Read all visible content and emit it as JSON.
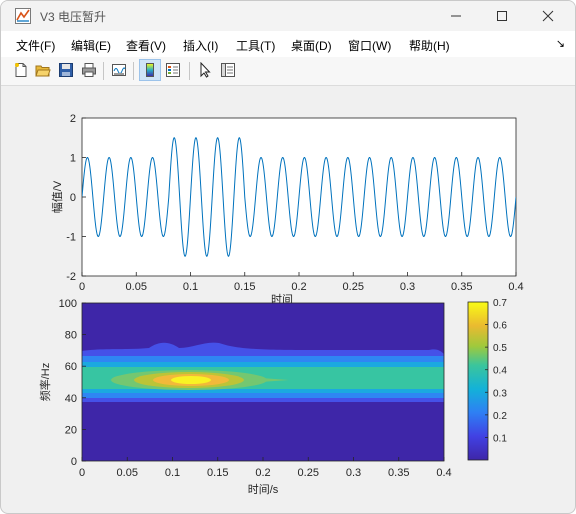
{
  "window": {
    "title": "V3 电压暂升",
    "icon": "matlab-figure-icon",
    "controls": [
      "minimize-icon",
      "maximize-icon",
      "close-icon"
    ]
  },
  "menu": {
    "items": [
      {
        "label": "文件(F)"
      },
      {
        "label": "编辑(E)"
      },
      {
        "label": "查看(V)"
      },
      {
        "label": "插入(I)"
      },
      {
        "label": "工具(T)"
      },
      {
        "label": "桌面(D)"
      },
      {
        "label": "窗口(W)"
      },
      {
        "label": "帮助(H)"
      }
    ],
    "overflow_icon": "dock-arrow-icon"
  },
  "toolbar": {
    "buttons": [
      "new-figure-icon",
      "open-icon",
      "save-icon",
      "print-icon",
      "link-plot-icon",
      "insert-colorbar-icon",
      "insert-legend-icon",
      "edit-plot-arrow-icon",
      "property-inspector-icon"
    ]
  },
  "chart_data": [
    {
      "type": "line",
      "title": "",
      "xlabel": "时间",
      "ylabel": "幅值/V",
      "xlim": [
        0,
        0.4
      ],
      "ylim": [
        -2,
        2
      ],
      "xticks": [
        "0",
        "0.05",
        "0.1",
        "0.15",
        "0.2",
        "0.25",
        "0.3",
        "0.35",
        "0.4"
      ],
      "yticks": [
        "-2",
        "-1",
        "0",
        "1",
        "2"
      ],
      "series": [
        {
          "frequency_hz": 50,
          "amplitude_normal": 1.0,
          "amplitude_swell": 1.5,
          "swell_interval": [
            0.08,
            0.15
          ],
          "color": "#0072bd"
        }
      ],
      "grid": false
    },
    {
      "type": "heatmap",
      "title": "",
      "xlabel": "时间/s",
      "ylabel": "频率/Hz",
      "xlim": [
        0,
        0.4
      ],
      "ylim": [
        0,
        100
      ],
      "xticks": [
        "0",
        "0.05",
        "0.1",
        "0.15",
        "0.2",
        "0.25",
        "0.3",
        "0.35",
        "0.4"
      ],
      "yticks": [
        "0",
        "20",
        "40",
        "60",
        "80",
        "100"
      ],
      "colorbar": {
        "range": [
          0,
          0.7
        ],
        "ticks": [
          "0.1",
          "0.2",
          "0.3",
          "0.4",
          "0.5",
          "0.6",
          "0.7"
        ],
        "colormap": "parula"
      },
      "peak": {
        "time": 0.12,
        "frequency": 50,
        "magnitude": 0.7
      }
    }
  ]
}
